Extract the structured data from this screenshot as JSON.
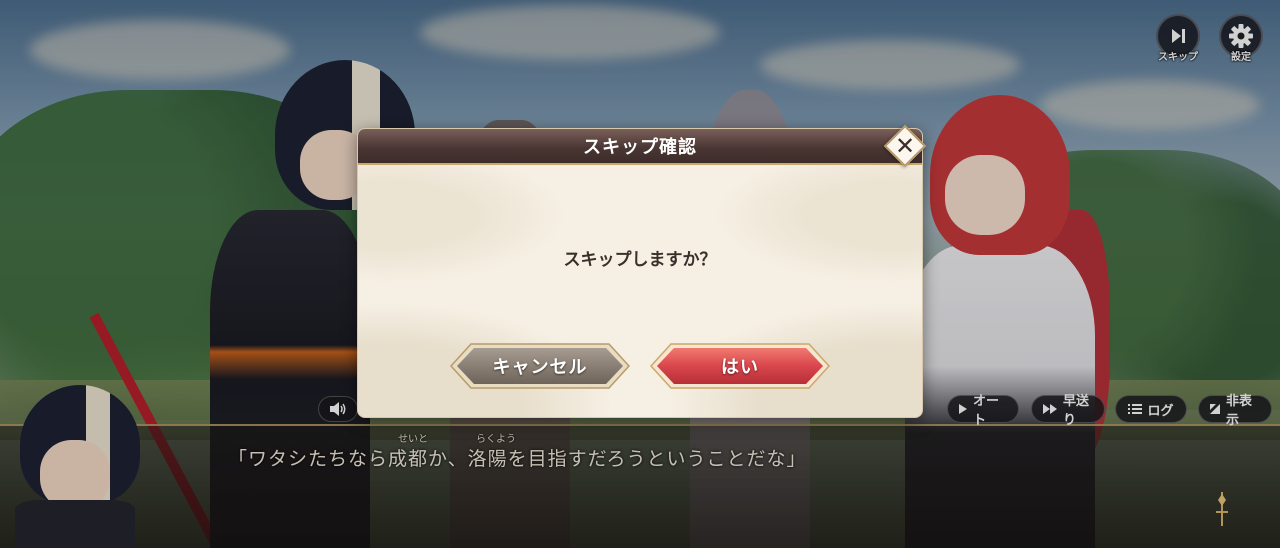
{
  "hud": {
    "skip_label": "スキップ",
    "settings_label": "設定",
    "skip_icon": "skip-forward-icon",
    "settings_icon": "gear-icon"
  },
  "dialogue": {
    "line": "「ワタシたちなら成都か、洛陽を目指すだろうということだな」",
    "ruby": [
      {
        "text": "せいと",
        "over": "成都"
      },
      {
        "text": "らくよう",
        "over": "洛陽"
      }
    ]
  },
  "controls": {
    "auto_label": "オート",
    "fast_label": "早送り",
    "log_label": "ログ",
    "hide_label": "非表示"
  },
  "modal": {
    "title": "スキップ確認",
    "message": "スキップしますか？",
    "cancel_label": "キャンセル",
    "confirm_label": "はい"
  },
  "colors": {
    "modal_header": "#4a3633",
    "modal_body": "#f6f0e4",
    "cancel_button": "#8c8278",
    "confirm_button": "#d9464c",
    "gold_trim": "#c9a86c"
  }
}
